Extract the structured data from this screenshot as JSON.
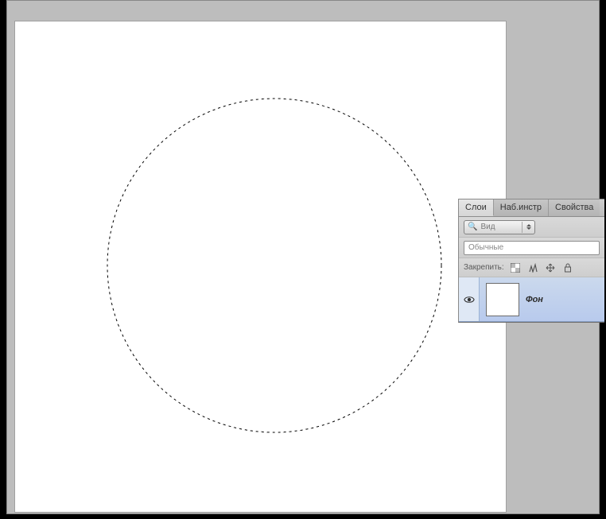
{
  "panel": {
    "tabs": {
      "layers": "Слои",
      "presets": "Наб.инстр",
      "properties": "Свойства"
    },
    "kind_dropdown": "Вид",
    "blend_mode": "Обычные",
    "lock_label": "Закрепить:",
    "layers": [
      {
        "name": "Фон"
      }
    ]
  }
}
